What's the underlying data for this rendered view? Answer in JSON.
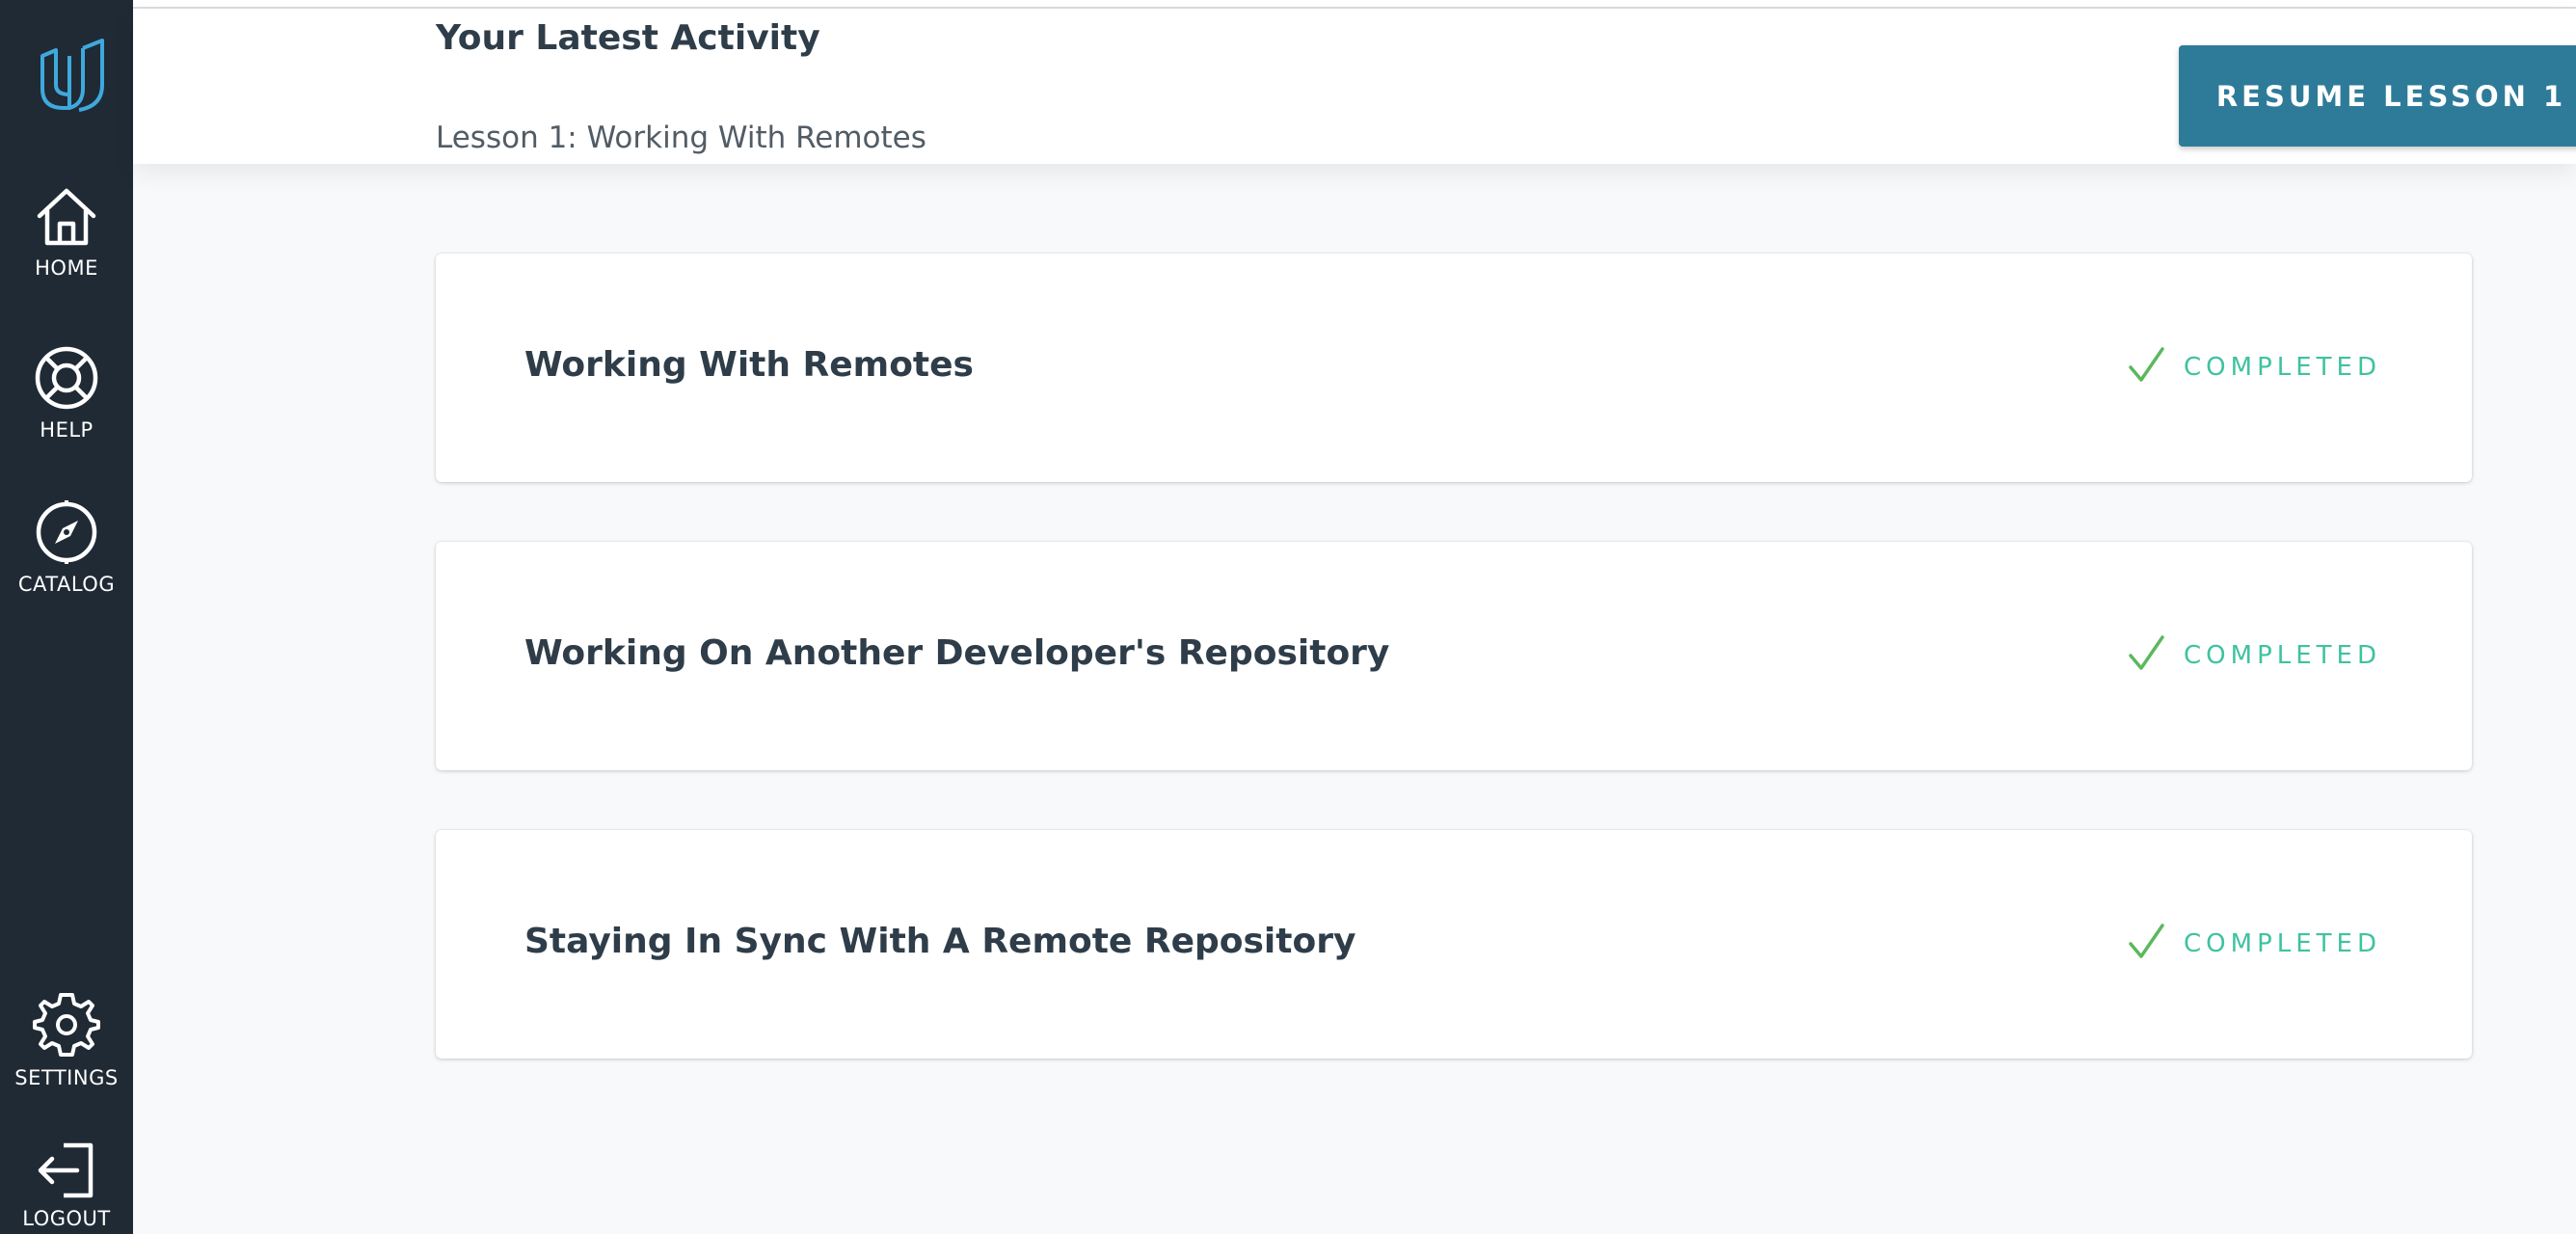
{
  "sidebar": {
    "items": [
      {
        "label": "HOME",
        "icon": "home-icon"
      },
      {
        "label": "HELP",
        "icon": "help-icon"
      },
      {
        "label": "CATALOG",
        "icon": "compass-icon"
      },
      {
        "label": "SETTINGS",
        "icon": "gear-icon"
      },
      {
        "label": "LOGOUT",
        "icon": "logout-icon"
      }
    ]
  },
  "header": {
    "title": "Your Latest Activity",
    "subtitle": "Lesson 1: Working With Remotes",
    "resume_label": "RESUME LESSON 1"
  },
  "concepts": [
    {
      "title": "Working With Remotes",
      "status": "COMPLETED"
    },
    {
      "title": "Working On Another Developer's Repository",
      "status": "COMPLETED"
    },
    {
      "title": "Staying In Sync With A Remote Repository",
      "status": "COMPLETED"
    }
  ],
  "colors": {
    "sidebar": "#1f2a35",
    "accent": "#2e7b99",
    "completed": "#3fc2a0",
    "logo": "#3fa9dd"
  }
}
